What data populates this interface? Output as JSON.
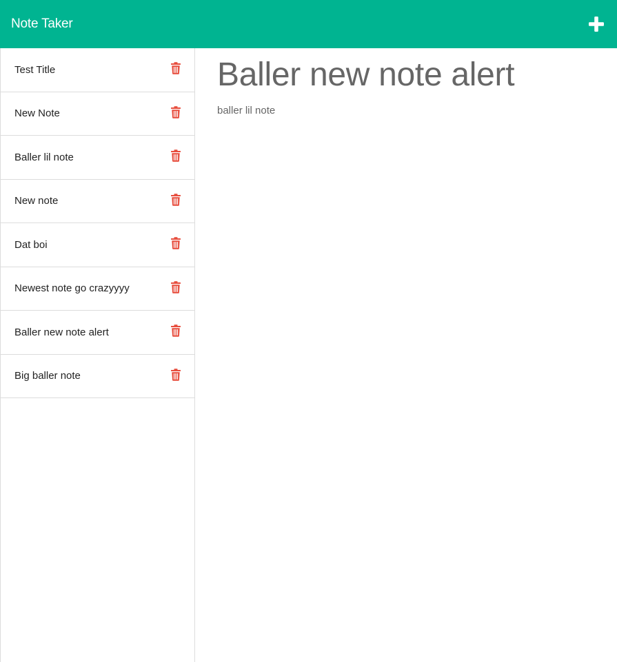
{
  "app": {
    "brand": "Note Taker",
    "accent_color": "#00b491",
    "delete_color": "#e74c3c",
    "add_icon": "plus-icon",
    "delete_icon": "trash-icon"
  },
  "notes": [
    {
      "title": "Test Title"
    },
    {
      "title": "New Note"
    },
    {
      "title": "Baller lil note"
    },
    {
      "title": "New note"
    },
    {
      "title": "Dat boi"
    },
    {
      "title": "Newest note go crazyyyy"
    },
    {
      "title": "Baller new note alert"
    },
    {
      "title": "Big baller note"
    }
  ],
  "active_note": {
    "title": "Baller new note alert",
    "text": "baller lil note"
  }
}
